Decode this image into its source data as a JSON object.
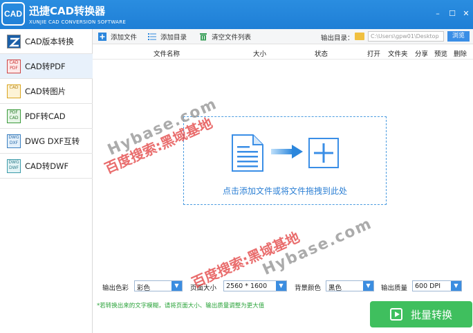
{
  "window": {
    "title": "迅捷CAD转换器",
    "subtitle": "XUNJIE CAD CONVERSION SOFTWARE",
    "logo_text": "CAD",
    "minimize_glyph": "–",
    "maximize_glyph": "☐",
    "close_glyph": "✕"
  },
  "sidebar": {
    "items": [
      {
        "label": "CAD版本转换",
        "icon": "cad-version-icon"
      },
      {
        "label": "CAD转PDF",
        "icon": "cad-to-pdf-icon",
        "icon_text": "CAD PDF"
      },
      {
        "label": "CAD转图片",
        "icon": "cad-to-image-icon",
        "icon_text": "CAD"
      },
      {
        "label": "PDF转CAD",
        "icon": "pdf-to-cad-icon",
        "icon_text": "PDF CAD"
      },
      {
        "label": "DWG DXF互转",
        "icon": "dwg-dxf-icon",
        "icon_text": "DWG DXF"
      },
      {
        "label": "CAD转DWF",
        "icon": "cad-to-dwf-icon",
        "icon_text": "DWG DWF"
      }
    ],
    "active_index": 1
  },
  "toolbar": {
    "add_file": "添加文件",
    "add_folder": "添加目录",
    "clear_list": "清空文件列表",
    "output_label": "输出目录：",
    "output_path": "C:\\Users\\gpw01\\Desktop",
    "browse": "浏览"
  },
  "columns": [
    "文件名称",
    "大小",
    "状态",
    "打开",
    "文件夹",
    "分享",
    "预览",
    "删除"
  ],
  "dropzone": {
    "hint": "点击添加文件或将文件拖拽到此处"
  },
  "options": {
    "color_label": "输出色彩",
    "color_value": "彩色",
    "page_label": "页面大小",
    "page_value": "2560 * 1600",
    "bg_label": "背景颜色",
    "bg_value": "黑色",
    "quality_label": "输出质量",
    "quality_value": "600 DPI"
  },
  "tip": "*若转换出来的文字模糊，请将页面大小、输出质量调整为更大值",
  "convert_button": "批量转换",
  "watermarks": {
    "red": "百度搜索:黑域基地",
    "gray": "Hybase.com"
  },
  "colors": {
    "titlebar": "#1f7fd6",
    "accent": "#3a8ee6",
    "convert": "#3fbf5e",
    "tip": "#2aa33a"
  }
}
